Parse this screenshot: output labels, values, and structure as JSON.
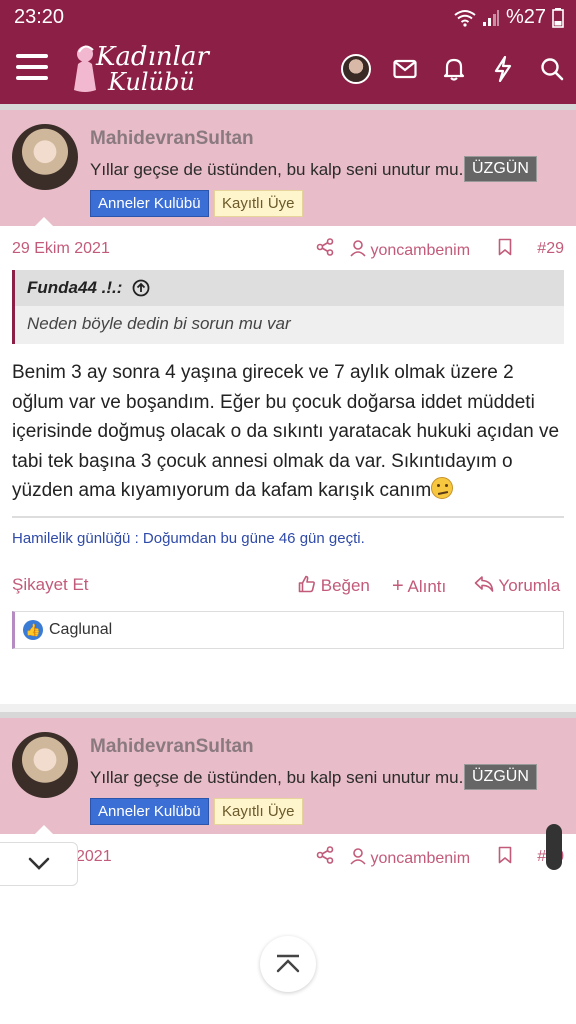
{
  "status_bar": {
    "time": "23:20",
    "battery": "%27"
  },
  "header": {
    "logo_line1": "Kadınlar",
    "logo_line2": "Kulübü"
  },
  "posts": [
    {
      "username": "MahidevranSultan",
      "user_title": "Yıllar geçse de üstünden, bu kalp seni unutur mu..",
      "mood_badge": "ÜZGÜN",
      "badge_group": "Anneler Kulübü",
      "badge_role": "Kayıtlı Üye",
      "date": "29 Ekim 2021",
      "author_link": "yoncambenim",
      "post_number": "#29",
      "quote_author": "Funda44 .!.:",
      "quote_text": "Neden böyle dedin bi sorun mu var",
      "body": "Benim 3 ay sonra 4 yaşına girecek ve 7 aylık olmak üzere 2 oğlum var ve boşandım. Eğer bu çocuk doğarsa iddet müddeti içerisinde doğmuş olacak o da sıkıntı yaratacak hukuki açıdan ve tabi tek başına 3 çocuk annesi olmak da var. Sıkıntıdayım o yüzden ama kıyamıyorum da kafam karışık canım",
      "signature": "Hamilelik günlüğü : Doğumdan bu güne 46 gün geçti.",
      "actions": {
        "report": "Şikayet Et",
        "like": "Beğen",
        "quote": "Alıntı",
        "reply": "Yorumla"
      },
      "liked_by": "Caglunal"
    },
    {
      "username": "MahidevranSultan",
      "user_title": "Yıllar geçse de üstünden, bu kalp seni unutur mu..",
      "mood_badge": "ÜZGÜN",
      "badge_group": "Anneler Kulübü",
      "badge_role": "Kayıtlı Üye",
      "date_partial": "2021",
      "author_link": "yoncambenim",
      "post_number_partial": "#30"
    }
  ],
  "colors": {
    "brand": "#8c1f45",
    "header_pink": "#e8bcc8",
    "link": "#c25b7a"
  }
}
